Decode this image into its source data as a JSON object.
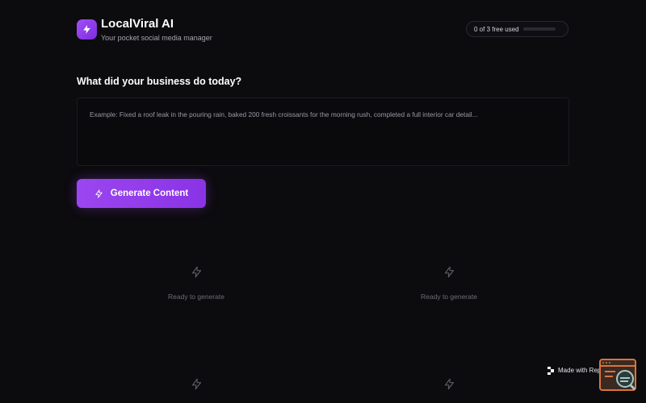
{
  "header": {
    "app_name": "LocalViral AI",
    "tagline": "Your pocket social media manager",
    "logo_icon": "lightning-bolt-icon",
    "brand_color": "#9b46f0"
  },
  "usage": {
    "label": "0 of 3 free used",
    "used": 0,
    "total": 3
  },
  "prompt": {
    "question": "What did your business do today?",
    "value": "",
    "placeholder": "Example: Fixed a roof leak in the pouring rain, baked 200 fresh croissants for the morning rush, completed a full interior car detail..."
  },
  "generate_button": {
    "label": "Generate Content",
    "icon": "lightning-bolt-icon"
  },
  "cards": [
    {
      "status": "Ready to generate",
      "icon": "lightning-bolt-icon"
    },
    {
      "status": "Ready to generate",
      "icon": "lightning-bolt-icon"
    },
    {
      "status": "",
      "icon": "lightning-bolt-icon"
    },
    {
      "status": "",
      "icon": "lightning-bolt-icon"
    }
  ],
  "badge": {
    "label": "Made with Replit"
  }
}
